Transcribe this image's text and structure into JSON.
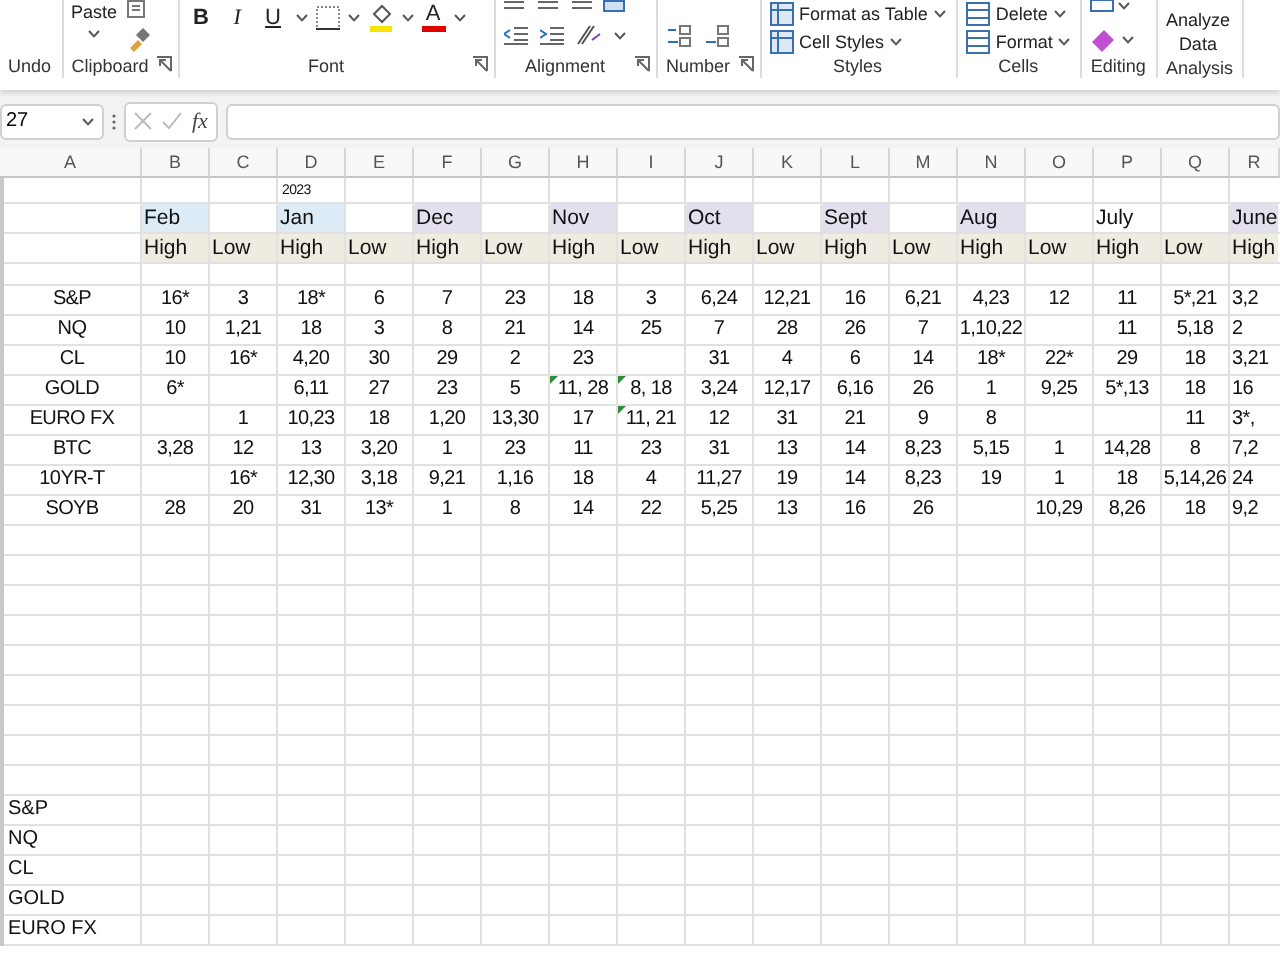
{
  "ribbon": {
    "groups": [
      {
        "kind": "undo",
        "label": "Undo",
        "launcher": false
      },
      {
        "kind": "clipboard",
        "label": "Clipboard",
        "launcher": true,
        "buttons": [
          {
            "label": "Paste"
          }
        ]
      },
      {
        "kind": "font",
        "label": "Font",
        "launcher": true,
        "buttons": [
          {
            "label": "B"
          },
          {
            "label": "I"
          },
          {
            "label": "U"
          },
          {
            "label": "A"
          }
        ]
      },
      {
        "kind": "alignment",
        "label": "Alignment",
        "launcher": true
      },
      {
        "kind": "number",
        "label": "Number",
        "launcher": true
      },
      {
        "kind": "styles",
        "label": "Styles",
        "launcher": false,
        "buttons": [
          {
            "label": "Format as Table"
          },
          {
            "label": "Cell Styles"
          }
        ]
      },
      {
        "kind": "cells",
        "label": "Cells",
        "launcher": false,
        "buttons": [
          {
            "label": "Delete"
          },
          {
            "label": "Format"
          }
        ]
      },
      {
        "kind": "editing",
        "label": "Editing",
        "launcher": false
      },
      {
        "kind": "analysis",
        "label": "Analysis",
        "launcher": false,
        "buttons": [
          {
            "label": "Analyze Data"
          }
        ]
      }
    ]
  },
  "formula_bar": {
    "name_box": "27",
    "fx": "fx"
  },
  "sheet": {
    "column_headers": [
      "A",
      "B",
      "C",
      "D",
      "E",
      "F",
      "G",
      "H",
      "I",
      "J",
      "K",
      "L",
      "M",
      "N",
      "O",
      "P",
      "Q",
      "R"
    ],
    "year": "2023",
    "months": [
      {
        "label": "Feb",
        "color": "#ddebf7"
      },
      {
        "label": "Jan",
        "color": "#ddebf7"
      },
      {
        "label": "Dec",
        "color": "#e4dfec"
      },
      {
        "label": "Nov",
        "color": "#e4dfec"
      },
      {
        "label": "Oct",
        "color": "#e4dfec"
      },
      {
        "label": "Sept",
        "color": "#e4dfec"
      },
      {
        "label": "Aug",
        "color": "#e4dfec"
      },
      {
        "label": "July",
        "color": "#ffffff"
      },
      {
        "label": "June",
        "color": "#e4dfec"
      }
    ],
    "subheaders": [
      "High",
      "Low",
      "High",
      "Low",
      "High",
      "Low",
      "High",
      "Low",
      "High",
      "Low",
      "High",
      "Low",
      "High",
      "Low",
      "High",
      "Low",
      "High"
    ],
    "rows": [
      {
        "label": "S&P",
        "cells": [
          {
            "text": "16*",
            "flagged": false
          },
          {
            "text": "3",
            "flagged": false
          },
          {
            "text": "18*",
            "flagged": false
          },
          {
            "text": "6",
            "flagged": false
          },
          {
            "text": "7",
            "flagged": false
          },
          {
            "text": "23",
            "flagged": false
          },
          {
            "text": "18",
            "flagged": false
          },
          {
            "text": "3",
            "flagged": false
          },
          {
            "text": "6,24",
            "flagged": false
          },
          {
            "text": "12,21",
            "flagged": false
          },
          {
            "text": "16",
            "flagged": false
          },
          {
            "text": "6,21",
            "flagged": false
          },
          {
            "text": "4,23",
            "flagged": false
          },
          {
            "text": "12",
            "flagged": false
          },
          {
            "text": "11",
            "flagged": false
          },
          {
            "text": "5*,21",
            "flagged": false
          },
          {
            "text": "3,2",
            "flagged": false
          }
        ]
      },
      {
        "label": "NQ",
        "cells": [
          {
            "text": "10",
            "flagged": false
          },
          {
            "text": "1,21",
            "flagged": false
          },
          {
            "text": "18",
            "flagged": false
          },
          {
            "text": "3",
            "flagged": false
          },
          {
            "text": "8",
            "flagged": false
          },
          {
            "text": "21",
            "flagged": false
          },
          {
            "text": "14",
            "flagged": false
          },
          {
            "text": "25",
            "flagged": false
          },
          {
            "text": "7",
            "flagged": false
          },
          {
            "text": "28",
            "flagged": false
          },
          {
            "text": "26",
            "flagged": false
          },
          {
            "text": "7",
            "flagged": false
          },
          {
            "text": "1,10,22",
            "flagged": false
          },
          null,
          {
            "text": "11",
            "flagged": false
          },
          {
            "text": "5,18",
            "flagged": false
          },
          {
            "text": "2",
            "flagged": false
          }
        ]
      },
      {
        "label": "CL",
        "cells": [
          {
            "text": "10",
            "flagged": false
          },
          {
            "text": "16*",
            "flagged": false
          },
          {
            "text": "4,20",
            "flagged": false
          },
          {
            "text": "30",
            "flagged": false
          },
          {
            "text": "29",
            "flagged": false
          },
          {
            "text": "2",
            "flagged": false
          },
          {
            "text": "23",
            "flagged": false
          },
          null,
          {
            "text": "31",
            "flagged": false
          },
          {
            "text": "4",
            "flagged": false
          },
          {
            "text": "6",
            "flagged": false
          },
          {
            "text": "14",
            "flagged": false
          },
          {
            "text": "18*",
            "flagged": false
          },
          {
            "text": "22*",
            "flagged": false
          },
          {
            "text": "29",
            "flagged": false
          },
          {
            "text": "18",
            "flagged": false
          },
          {
            "text": "3,21",
            "flagged": false
          }
        ]
      },
      {
        "label": "GOLD",
        "cells": [
          {
            "text": "6*",
            "flagged": false
          },
          null,
          {
            "text": "6,11",
            "flagged": false
          },
          {
            "text": "27",
            "flagged": false
          },
          {
            "text": "23",
            "flagged": false
          },
          {
            "text": "5",
            "flagged": false
          },
          {
            "text": "11, 28",
            "flagged": true
          },
          {
            "text": "8, 18",
            "flagged": true
          },
          {
            "text": "3,24",
            "flagged": false
          },
          {
            "text": "12,17",
            "flagged": false
          },
          {
            "text": "6,16",
            "flagged": false
          },
          {
            "text": "26",
            "flagged": false
          },
          {
            "text": "1",
            "flagged": false
          },
          {
            "text": "9,25",
            "flagged": false
          },
          {
            "text": "5*,13",
            "flagged": false
          },
          {
            "text": "18",
            "flagged": false
          },
          {
            "text": "16",
            "flagged": false
          }
        ]
      },
      {
        "label": "EURO FX",
        "cells": [
          null,
          {
            "text": "1",
            "flagged": false
          },
          {
            "text": "10,23",
            "flagged": false
          },
          {
            "text": "18",
            "flagged": false
          },
          {
            "text": "1,20",
            "flagged": false
          },
          {
            "text": "13,30",
            "flagged": false
          },
          {
            "text": "17",
            "flagged": false
          },
          {
            "text": "11, 21",
            "flagged": true
          },
          {
            "text": "12",
            "flagged": false
          },
          {
            "text": "31",
            "flagged": false
          },
          {
            "text": "21",
            "flagged": false
          },
          {
            "text": "9",
            "flagged": false
          },
          {
            "text": "8",
            "flagged": false
          },
          null,
          null,
          {
            "text": "11",
            "flagged": false
          },
          {
            "text": "3*,",
            "flagged": false
          }
        ]
      },
      {
        "label": "BTC",
        "cells": [
          {
            "text": "3,28",
            "flagged": false
          },
          {
            "text": "12",
            "flagged": false
          },
          {
            "text": "13",
            "flagged": false
          },
          {
            "text": "3,20",
            "flagged": false
          },
          {
            "text": "1",
            "flagged": false
          },
          {
            "text": "23",
            "flagged": false
          },
          {
            "text": "11",
            "flagged": false
          },
          {
            "text": "23",
            "flagged": false
          },
          {
            "text": "31",
            "flagged": false
          },
          {
            "text": "13",
            "flagged": false
          },
          {
            "text": "14",
            "flagged": false
          },
          {
            "text": "8,23",
            "flagged": false
          },
          {
            "text": "5,15",
            "flagged": false
          },
          {
            "text": "1",
            "flagged": false
          },
          {
            "text": "14,28",
            "flagged": false
          },
          {
            "text": "8",
            "flagged": false
          },
          {
            "text": "7,2",
            "flagged": false
          }
        ]
      },
      {
        "label": "10YR-T",
        "cells": [
          null,
          {
            "text": "16*",
            "flagged": false
          },
          {
            "text": "12,30",
            "flagged": false
          },
          {
            "text": "3,18",
            "flagged": false
          },
          {
            "text": "9,21",
            "flagged": false
          },
          {
            "text": "1,16",
            "flagged": false
          },
          {
            "text": "18",
            "flagged": false
          },
          {
            "text": "4",
            "flagged": false
          },
          {
            "text": "11,27",
            "flagged": false
          },
          {
            "text": "19",
            "flagged": false
          },
          {
            "text": "14",
            "flagged": false
          },
          {
            "text": "8,23",
            "flagged": false
          },
          {
            "text": "19",
            "flagged": false
          },
          {
            "text": "1",
            "flagged": false
          },
          {
            "text": "18",
            "flagged": false
          },
          {
            "text": "5,14,26",
            "flagged": false
          },
          {
            "text": "24",
            "flagged": false
          }
        ]
      },
      {
        "label": "SOYB",
        "cells": [
          {
            "text": "28",
            "flagged": false
          },
          {
            "text": "20",
            "flagged": false
          },
          {
            "text": "31",
            "flagged": false
          },
          {
            "text": "13*",
            "flagged": false
          },
          {
            "text": "1",
            "flagged": false
          },
          {
            "text": "8",
            "flagged": false
          },
          {
            "text": "14",
            "flagged": false
          },
          {
            "text": "22",
            "flagged": false
          },
          {
            "text": "5,25",
            "flagged": false
          },
          {
            "text": "13",
            "flagged": false
          },
          {
            "text": "16",
            "flagged": false
          },
          {
            "text": "26",
            "flagged": false
          },
          null,
          {
            "text": "10,29",
            "flagged": false
          },
          {
            "text": "8,26",
            "flagged": false
          },
          {
            "text": "18",
            "flagged": false
          },
          {
            "text": "9,2",
            "flagged": false
          }
        ]
      }
    ],
    "lower_rows": [
      {
        "label": "S&P"
      },
      {
        "label": "NQ"
      },
      {
        "label": "CL"
      },
      {
        "label": "GOLD"
      },
      {
        "label": "EURO FX"
      }
    ]
  }
}
